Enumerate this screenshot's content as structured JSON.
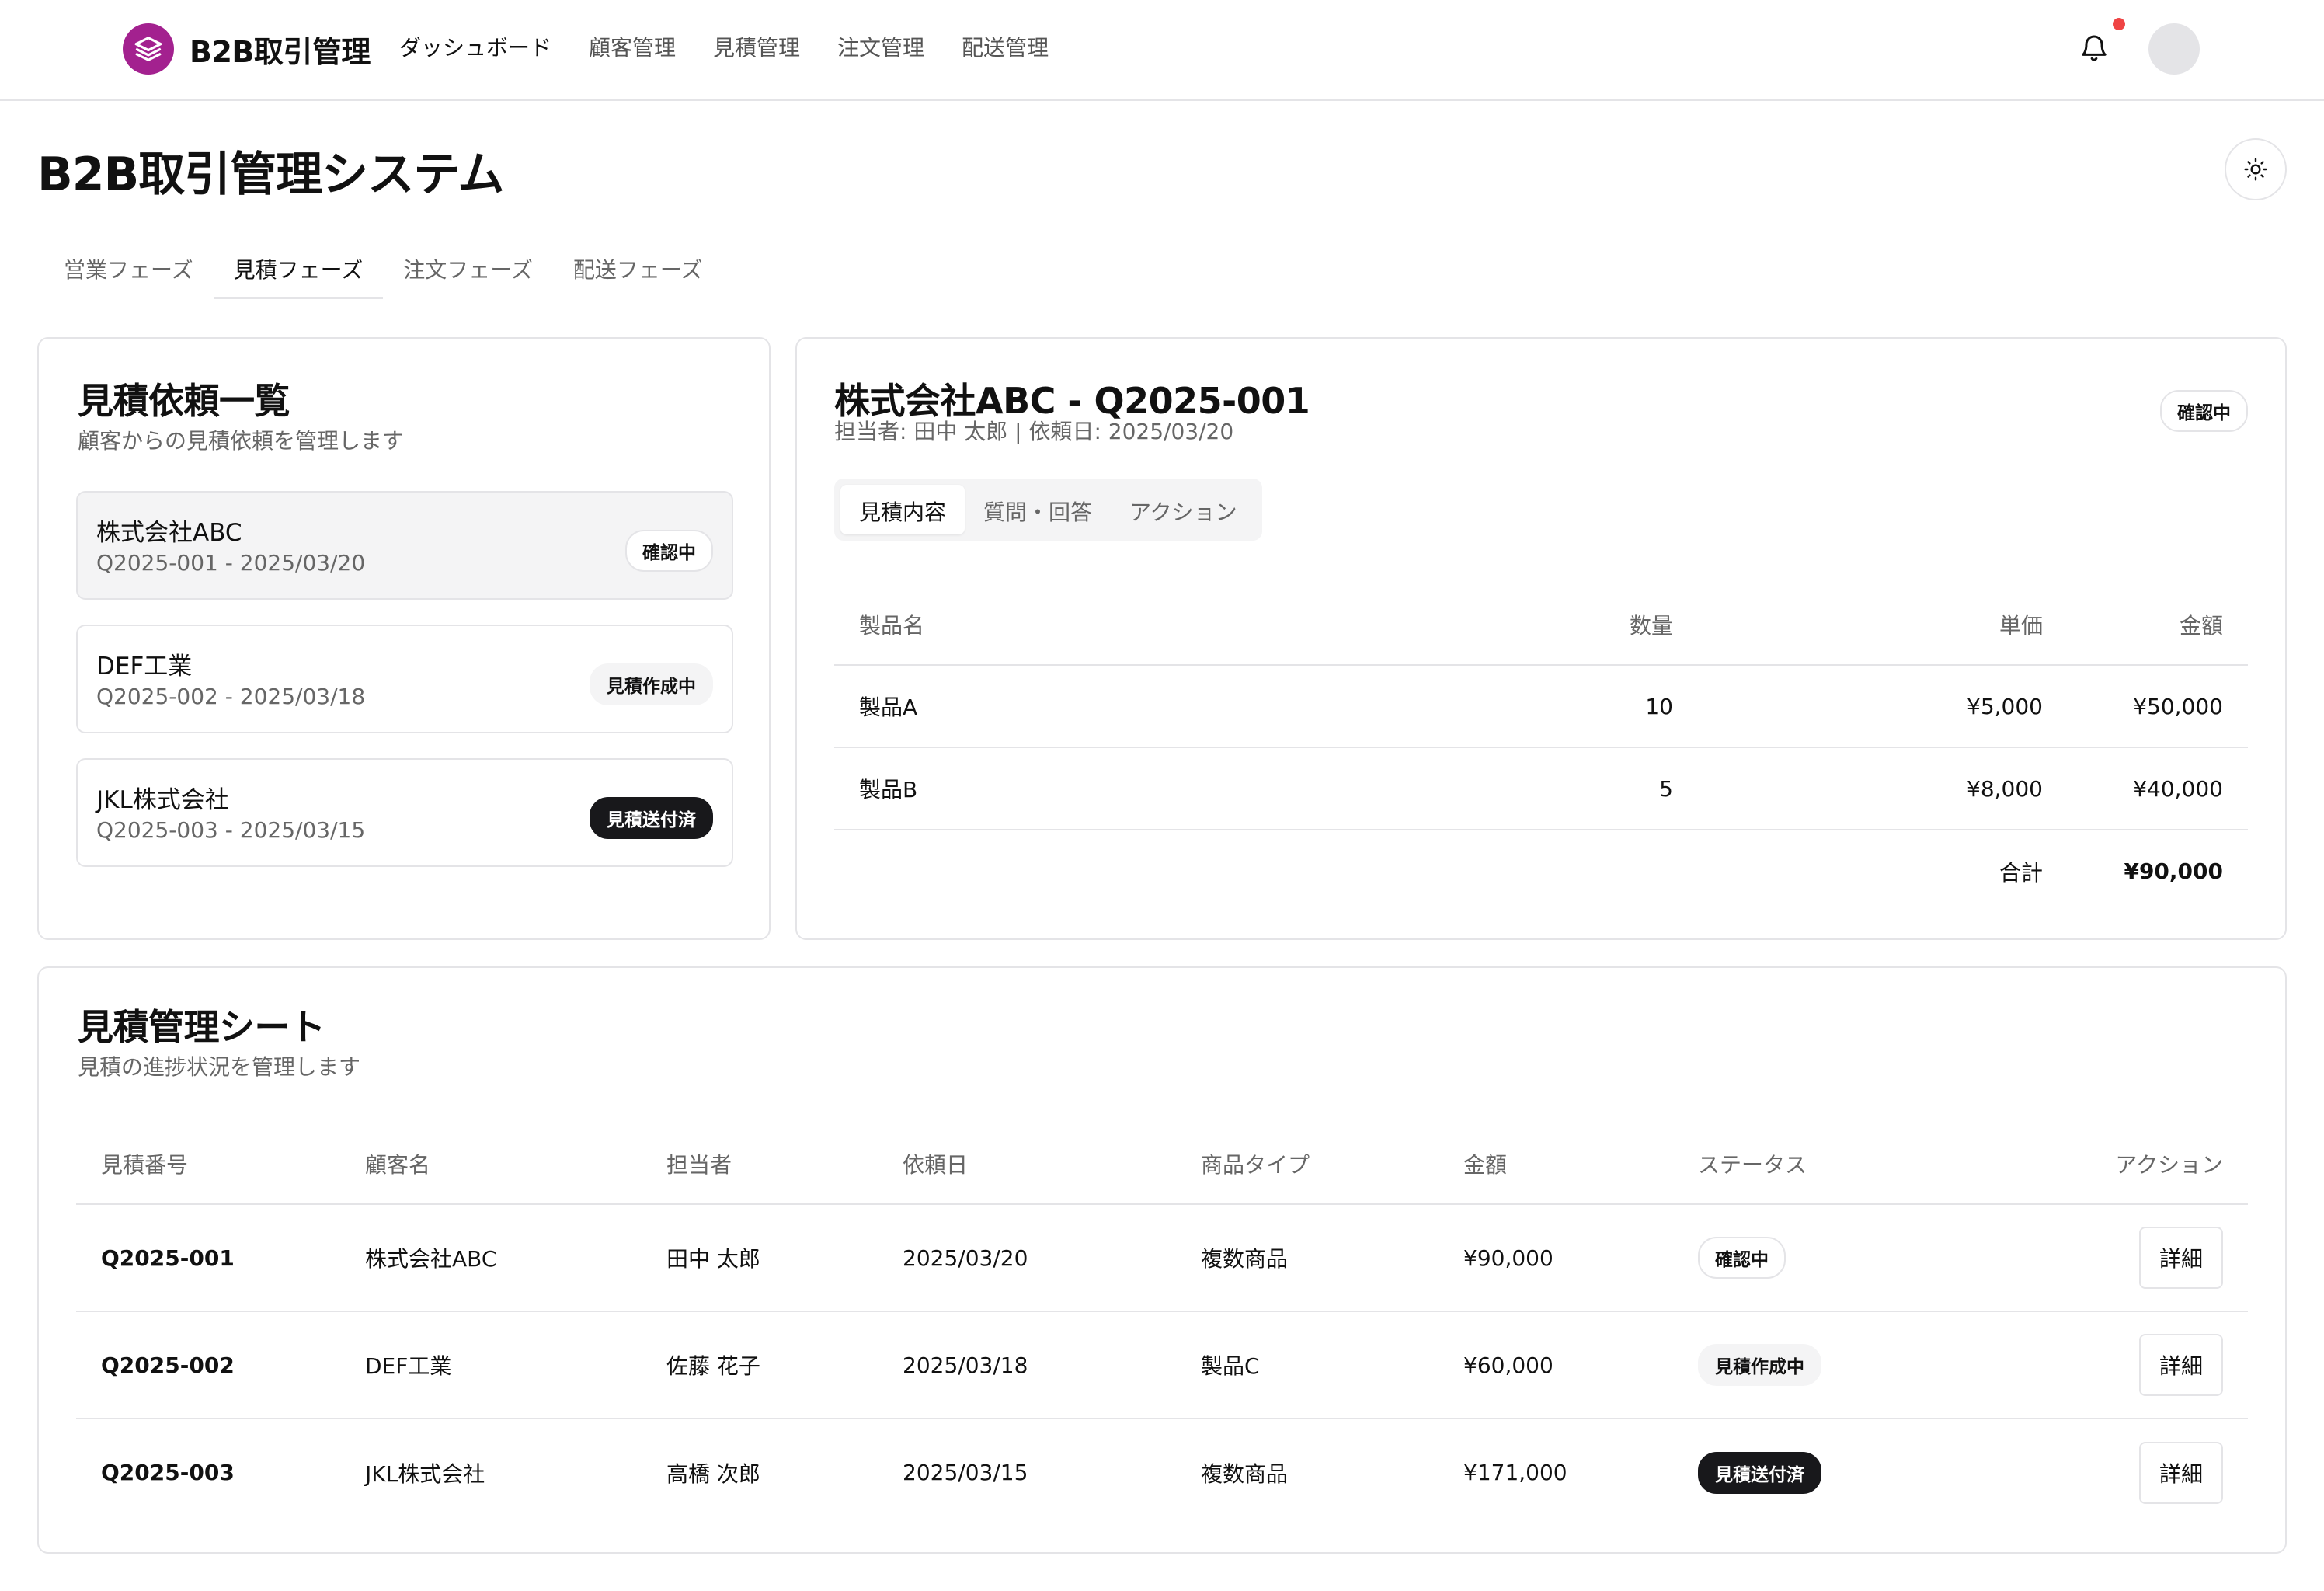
{
  "app": {
    "name": "B2B取引管理",
    "nav": [
      "ダッシュボード",
      "顧客管理",
      "見積管理",
      "注文管理",
      "配送管理"
    ]
  },
  "page": {
    "title": "B2B取引管理システム",
    "phase_tabs": [
      "営業フェーズ",
      "見積フェーズ",
      "注文フェーズ",
      "配送フェーズ"
    ],
    "active_phase": "見積フェーズ"
  },
  "requests": {
    "title": "見積依頼一覧",
    "subtitle": "顧客からの見積依頼を管理します",
    "items": [
      {
        "customer": "株式会社ABC",
        "meta": "Q2025-001 - 2025/03/20",
        "status": "確認中"
      },
      {
        "customer": "DEF工業",
        "meta": "Q2025-002 - 2025/03/18",
        "status": "見積作成中"
      },
      {
        "customer": "JKL株式会社",
        "meta": "Q2025-003 - 2025/03/15",
        "status": "見積送付済"
      }
    ]
  },
  "detail": {
    "title": "株式会社ABC - Q2025-001",
    "meta": "担当者: 田中 太郎 | 依頼日: 2025/03/20",
    "status": "確認中",
    "tabs": [
      "見積内容",
      "質問・回答",
      "アクション"
    ],
    "columns": [
      "製品名",
      "数量",
      "単価",
      "金額"
    ],
    "rows": [
      [
        "製品A",
        "10",
        "¥5,000",
        "¥50,000"
      ],
      [
        "製品B",
        "5",
        "¥8,000",
        "¥40,000"
      ]
    ],
    "total_label": "合計",
    "total_value": "¥90,000"
  },
  "sheet": {
    "title": "見積管理シート",
    "subtitle": "見積の進捗状況を管理します",
    "columns": [
      "見積番号",
      "顧客名",
      "担当者",
      "依頼日",
      "商品タイプ",
      "金額",
      "ステータス",
      "アクション"
    ],
    "rows": [
      [
        "Q2025-001",
        "株式会社ABC",
        "田中 太郎",
        "2025/03/20",
        "複数商品",
        "¥90,000",
        "確認中",
        "詳細"
      ],
      [
        "Q2025-002",
        "DEF工業",
        "佐藤 花子",
        "2025/03/18",
        "製品C",
        "¥60,000",
        "見積作成中",
        "詳細"
      ],
      [
        "Q2025-003",
        "JKL株式会社",
        "高橋 次郎",
        "2025/03/15",
        "複数商品",
        "¥171,000",
        "見積送付済",
        "詳細"
      ]
    ]
  },
  "icons": {
    "logo": "layers-icon",
    "notifications": "bell-icon",
    "theme": "sun-icon"
  },
  "colors": {
    "brand": "#a3218f",
    "notification_dot": "#ef4444",
    "badge_dark": "#18181b",
    "border": "#e4e4e7"
  }
}
